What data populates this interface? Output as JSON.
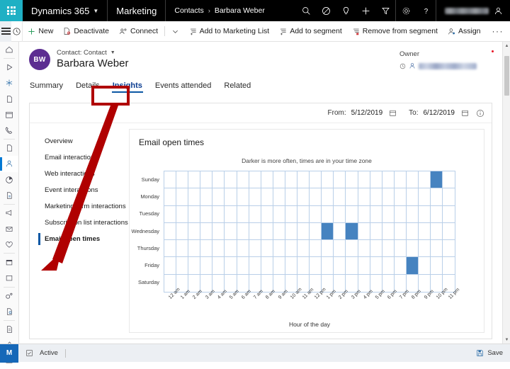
{
  "topnav": {
    "waffle_label": "app-launcher",
    "brand": "Dynamics 365",
    "app_name": "Marketing",
    "breadcrumb": [
      "Contacts",
      "Barbara Weber"
    ],
    "breadcrumb_separator": "›",
    "icons": [
      "search-icon",
      "assistant-icon",
      "idea-icon",
      "quick-create-icon",
      "filter-icon",
      "settings-icon",
      "help-icon"
    ],
    "user_name_redacted": true
  },
  "commandbar": {
    "menu_label": "site-map",
    "recent_label": "recently-viewed",
    "items": [
      {
        "label": "New",
        "icon": "plus-icon"
      },
      {
        "label": "Deactivate",
        "icon": "deactivate-icon"
      },
      {
        "label": "Connect",
        "icon": "connect-icon"
      },
      {
        "label": "Add to Marketing List",
        "icon": "add-list-icon"
      },
      {
        "label": "Add to segment",
        "icon": "add-segment-icon"
      },
      {
        "label": "Remove from segment",
        "icon": "remove-segment-icon"
      },
      {
        "label": "Assign",
        "icon": "assign-icon"
      }
    ],
    "overflow_label": "···"
  },
  "record": {
    "avatar_initials": "BW",
    "type_label": "Contact: Contact",
    "name": "Barbara Weber",
    "owner_label": "Owner",
    "owner_redacted": true
  },
  "tabs": [
    {
      "label": "Summary",
      "active": false
    },
    {
      "label": "Details",
      "active": false
    },
    {
      "label": "Insights",
      "active": true
    },
    {
      "label": "Events attended",
      "active": false
    },
    {
      "label": "Related",
      "active": false
    }
  ],
  "daterange": {
    "from_label": "From:",
    "from_value": "5/12/2019",
    "to_label": "To:",
    "to_value": "6/12/2019",
    "calendar_icon": "calendar-icon",
    "info_icon": "info-icon"
  },
  "subnav": [
    {
      "label": "Overview",
      "selected": false
    },
    {
      "label": "Email interactions",
      "selected": false
    },
    {
      "label": "Web interactions",
      "selected": false
    },
    {
      "label": "Event interactions",
      "selected": false
    },
    {
      "label": "Marketing form interactions",
      "selected": false
    },
    {
      "label": "Subscription list interactions",
      "selected": false
    },
    {
      "label": "Email open times",
      "selected": true
    }
  ],
  "card": {
    "title": "Email open times"
  },
  "statusbar": {
    "app_badge": "M",
    "state_label": "Active",
    "save_label": "Save",
    "save_icon": "save-icon",
    "form_icon": "form-icon"
  },
  "colors": {
    "accent_teal": "#1fb0c4",
    "avatar_purple": "#5c2d91",
    "cell_blue": "#4683c0",
    "grid_blue": "#b9cfe8",
    "tab_underline": "#0b57a4",
    "annotation_red": "#b00000",
    "status_blue": "#1668b8"
  },
  "annotations": [
    {
      "type": "rectangle",
      "target": "tab-insights",
      "color": "#b00000"
    },
    {
      "type": "arrow",
      "from": "tab-insights",
      "to": "subnav-item-email-open-times",
      "color": "#b00000"
    }
  ],
  "chart_data": {
    "type": "heatmap",
    "title": "Email open times",
    "subtitle": "Darker is more often, times are in your time zone",
    "xlabel": "Hour of the day",
    "ylabel": "",
    "categories_y": [
      "Sunday",
      "Monday",
      "Tuesday",
      "Wednesday",
      "Thursday",
      "Friday",
      "Saturday"
    ],
    "categories_x": [
      "12 am",
      "1 am",
      "2 am",
      "3 am",
      "4 am",
      "5 am",
      "6 am",
      "7 am",
      "8 am",
      "9 am",
      "10 am",
      "11 am",
      "12 pm",
      "1 pm",
      "2 pm",
      "3 pm",
      "4 pm",
      "5 pm",
      "6 pm",
      "7 pm",
      "8 pm",
      "9 pm",
      "10 pm",
      "11 pm"
    ],
    "grid": true,
    "legend": "none",
    "values": [
      [
        0,
        0,
        0,
        0,
        0,
        0,
        0,
        0,
        0,
        0,
        0,
        0,
        0,
        0,
        0,
        0,
        0,
        0,
        0,
        0,
        0,
        0,
        1,
        0
      ],
      [
        0,
        0,
        0,
        0,
        0,
        0,
        0,
        0,
        0,
        0,
        0,
        0,
        0,
        0,
        0,
        0,
        0,
        0,
        0,
        0,
        0,
        0,
        0,
        0
      ],
      [
        0,
        0,
        0,
        0,
        0,
        0,
        0,
        0,
        0,
        0,
        0,
        0,
        0,
        0,
        0,
        0,
        0,
        0,
        0,
        0,
        0,
        0,
        0,
        0
      ],
      [
        0,
        0,
        0,
        0,
        0,
        0,
        0,
        0,
        0,
        0,
        0,
        0,
        0,
        1,
        0,
        1,
        0,
        0,
        0,
        0,
        0,
        0,
        0,
        0
      ],
      [
        0,
        0,
        0,
        0,
        0,
        0,
        0,
        0,
        0,
        0,
        0,
        0,
        0,
        0,
        0,
        0,
        0,
        0,
        0,
        0,
        0,
        0,
        0,
        0
      ],
      [
        0,
        0,
        0,
        0,
        0,
        0,
        0,
        0,
        0,
        0,
        0,
        0,
        0,
        0,
        0,
        0,
        0,
        0,
        0,
        0,
        1,
        0,
        0,
        0
      ],
      [
        0,
        0,
        0,
        0,
        0,
        0,
        0,
        0,
        0,
        0,
        0,
        0,
        0,
        0,
        0,
        0,
        0,
        0,
        0,
        0,
        0,
        0,
        0,
        0
      ]
    ],
    "highlighted_cells": [
      {
        "day": "Sunday",
        "hour": "10 pm"
      },
      {
        "day": "Wednesday",
        "hour": "1 pm"
      },
      {
        "day": "Wednesday",
        "hour": "3 pm"
      },
      {
        "day": "Friday",
        "hour": "8 pm"
      }
    ]
  }
}
